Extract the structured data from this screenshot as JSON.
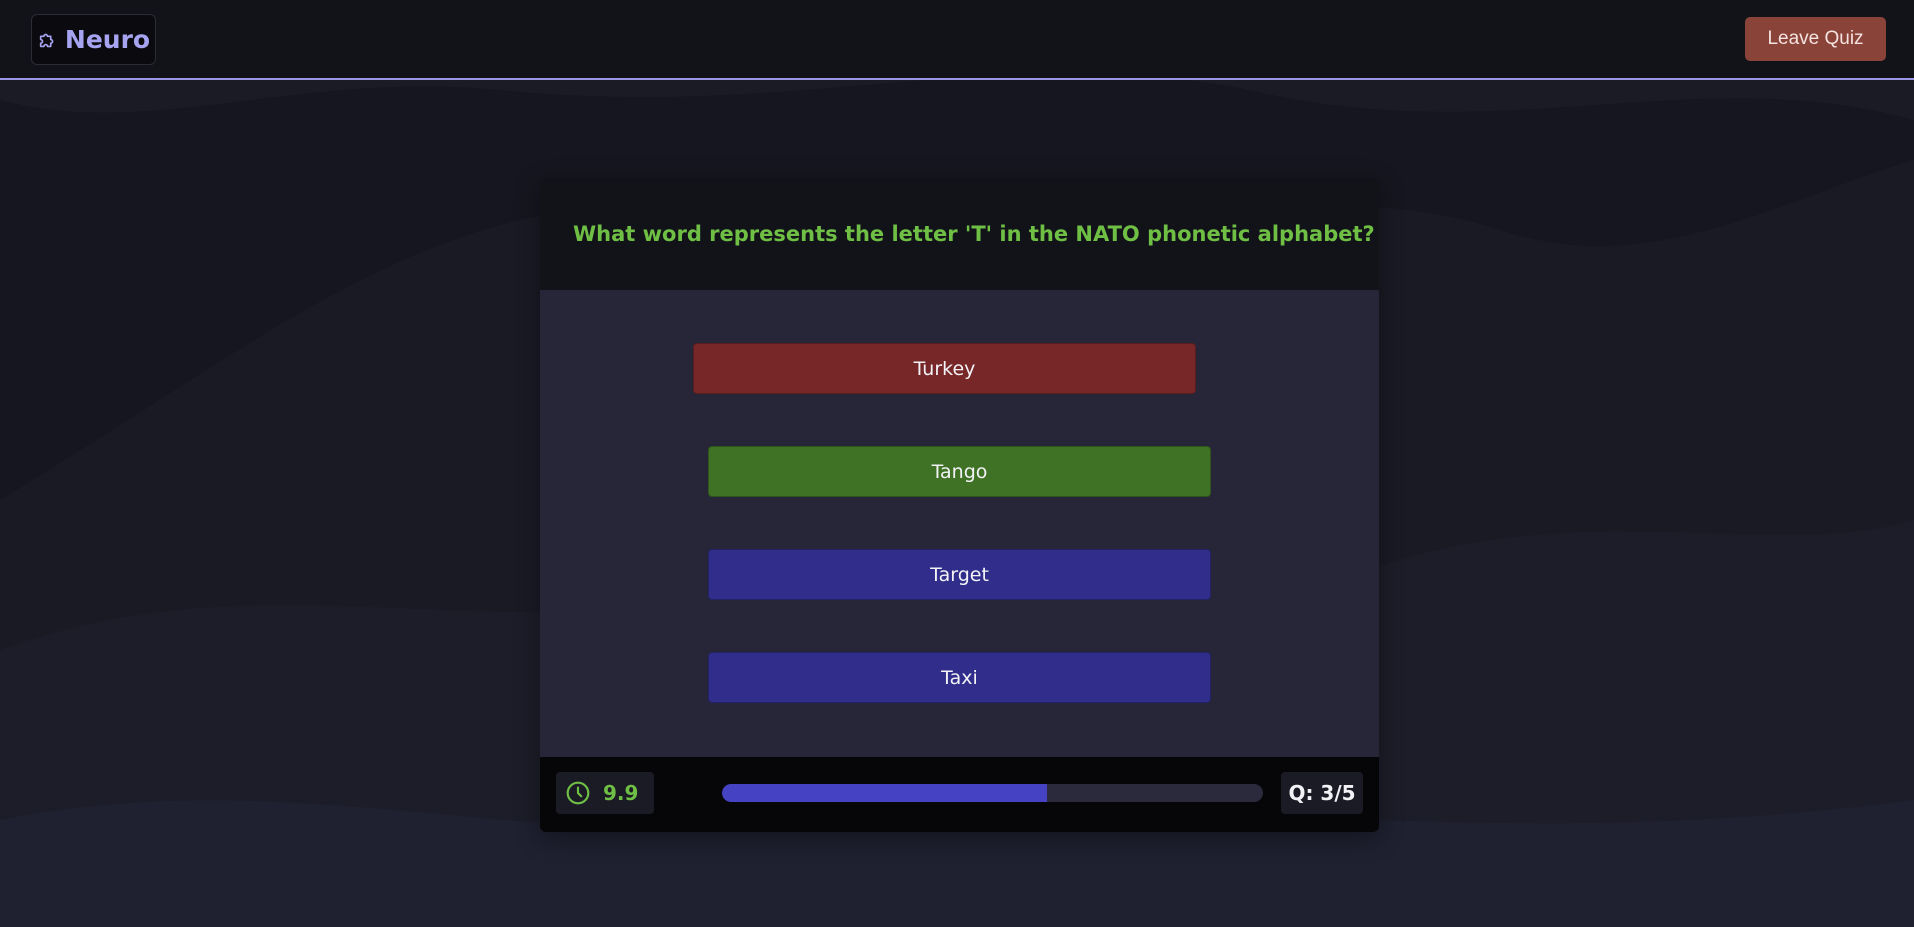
{
  "brand": {
    "name": "Neuro",
    "icon": "puzzle-icon"
  },
  "header": {
    "leave_label": "Leave Quiz"
  },
  "quiz": {
    "question": "What word represents the letter 'T' in the NATO phonetic alphabet?",
    "answers": [
      {
        "label": "Turkey",
        "state": "incorrect",
        "color": "#772727"
      },
      {
        "label": "Tango",
        "state": "correct",
        "color": "#3f7225"
      },
      {
        "label": "Target",
        "state": "default",
        "color": "#302e8a"
      },
      {
        "label": "Taxi",
        "state": "default",
        "color": "#302e8a"
      }
    ]
  },
  "footer": {
    "timer_icon": "clock-icon",
    "timer_value": "9.9",
    "progress": 0.6,
    "question_counter": "Q: 3/5"
  },
  "colors": {
    "accent": "#a6a3f0",
    "question_text": "#6fbf45",
    "progress_fill": "#4543c4",
    "leave_button": "#8a4339"
  }
}
